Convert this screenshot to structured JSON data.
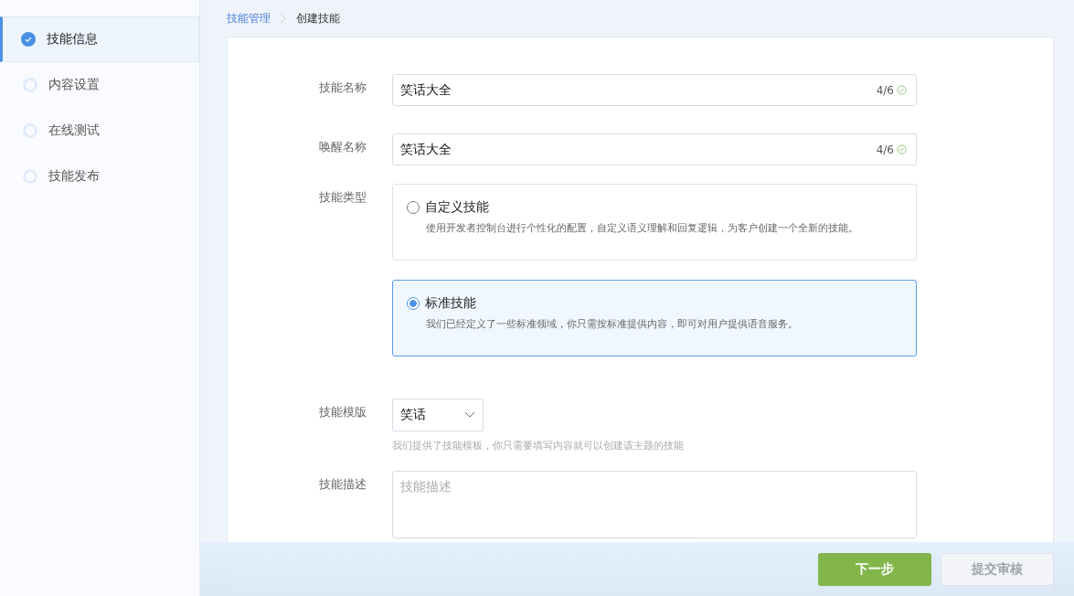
{
  "steps": [
    {
      "label": "技能信息",
      "selected": true
    },
    {
      "label": "内容设置",
      "selected": false
    },
    {
      "label": "在线测试",
      "selected": false
    },
    {
      "label": "技能发布",
      "selected": false
    }
  ],
  "breadcrumb": {
    "parent": "技能管理",
    "current": "创建技能"
  },
  "form": {
    "name": {
      "label": "技能名称",
      "value": "笑话大全",
      "counter": "4/6",
      "valid": true
    },
    "wake_name": {
      "label": "唤醒名称",
      "value": "笑话大全",
      "counter": "4/6",
      "valid": true
    },
    "type": {
      "label": "技能类型",
      "options": [
        {
          "title": "自定义技能",
          "description": "使用开发者控制台进行个性化的配置，自定义语义理解和回复逻辑，为客户创建一个全新的技能。",
          "selected": false
        },
        {
          "title": "标准技能",
          "description": "我们已经定义了一些标准领域，你只需按标准提供内容，即可对用户提供语音服务。",
          "selected": true
        }
      ]
    },
    "template": {
      "label": "技能模版",
      "value": "笑话",
      "hint": "我们提供了技能模板，你只需要填写内容就可以创建该主题的技能"
    },
    "description": {
      "label": "技能描述",
      "placeholder": "技能描述"
    }
  },
  "buttons": [
    {
      "label": "下一步",
      "disabled": false
    },
    {
      "label": "提交审核",
      "disabled": true
    }
  ]
}
